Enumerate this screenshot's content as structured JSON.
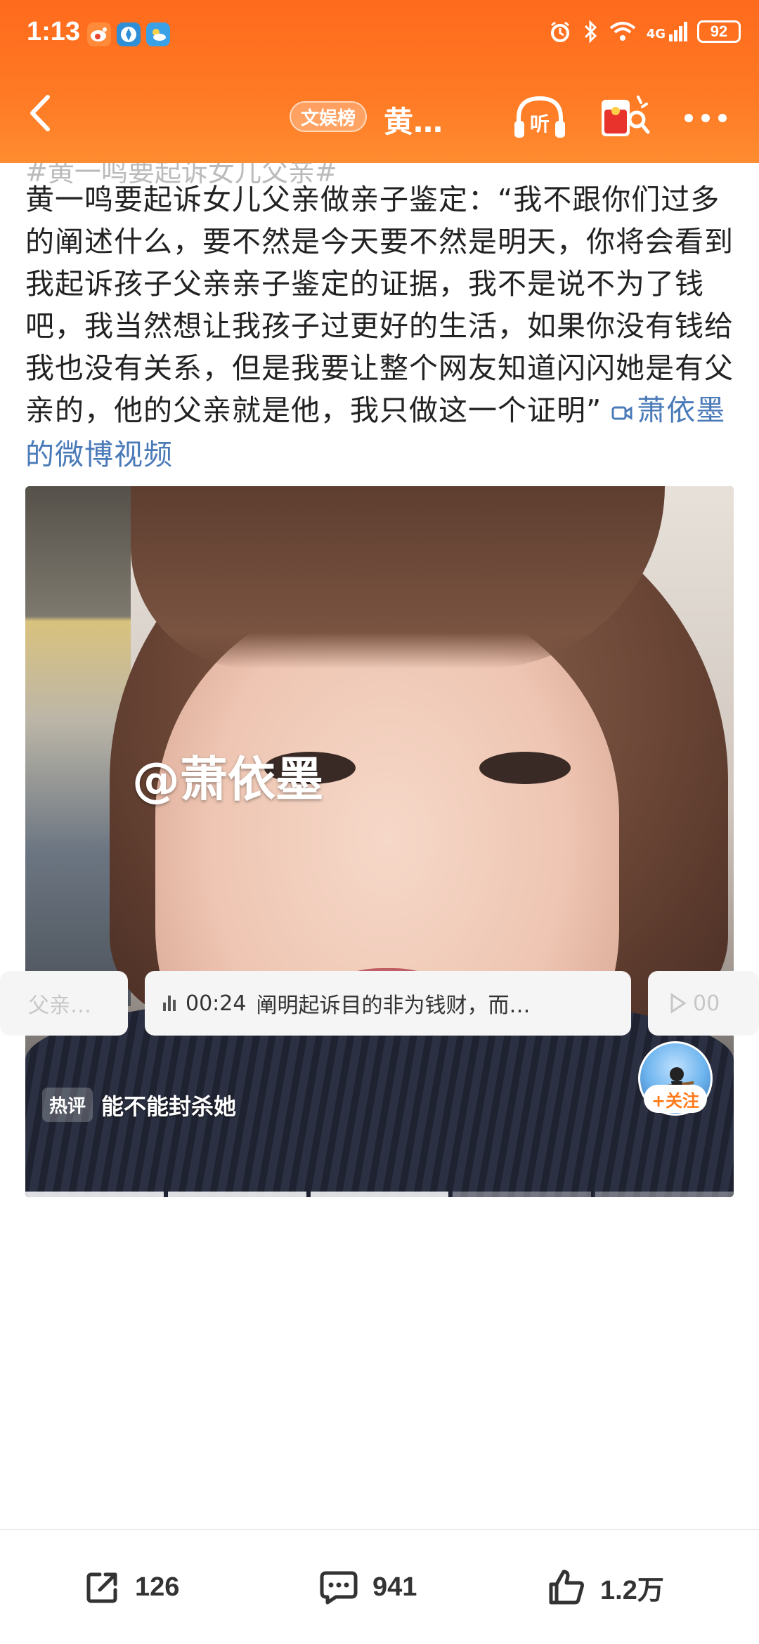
{
  "status_bar": {
    "time": "1:13",
    "network": "4G",
    "battery": "92",
    "apps": [
      "weibo-app-icon",
      "browser-app-icon",
      "weather-app-icon"
    ]
  },
  "nav": {
    "rank_label": "文娱榜",
    "title": "黄…"
  },
  "post": {
    "hashtag": "#黄一鸣要起诉女儿父亲#",
    "text": "黄一鸣要起诉女儿父亲做亲子鉴定：“我不跟你们过多的阐述什么，要不然是今天要不然是明天，你将会看到我起诉孩子父亲亲子鉴定的证据，我不是说不为了钱吧，我当然想让我孩子过更好的生活，如果你没有钱给我也没有关系，但是我要让整个网友知道闪闪她是有父亲的，他的父亲就是他，我只做这一个证明”",
    "video_link": "萧依墨的微博视频"
  },
  "video": {
    "watermark": "@萧依墨",
    "hot_tag": "热评",
    "hot_comment": "能不能封杀她",
    "follow_label": "+关注",
    "segments_watched": 3,
    "segments_total": 5
  },
  "chapters": {
    "prev": "父亲…",
    "current_time": "00:24",
    "current_text": "阐明起诉目的非为钱财，而…",
    "next": "00"
  },
  "actions": {
    "share_count": "126",
    "comment_count": "941",
    "like_count": "1.2万"
  },
  "colors": {
    "header": "#ff7a24",
    "link": "#4a7ab8",
    "follow": "#ff7a1a"
  }
}
